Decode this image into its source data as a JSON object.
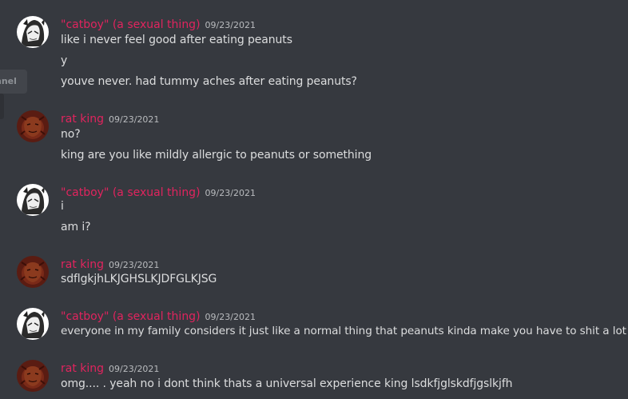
{
  "side_channel_label": "nnel",
  "messages": [
    {
      "author": "\"catboy\" (a sexual thing)",
      "time": "09/23/2021",
      "lines": [
        "like i never feel good after eating peanuts",
        "y",
        "youve never. had tummy aches after eating peanuts?"
      ]
    },
    {
      "author": "rat king",
      "time": "09/23/2021",
      "lines": [
        "no?",
        "king are you like mildly allergic to peanuts or something"
      ]
    },
    {
      "author": "\"catboy\" (a sexual thing)",
      "time": "09/23/2021",
      "lines": [
        "i",
        "am i?"
      ]
    },
    {
      "author": "rat king",
      "time": "09/23/2021",
      "lines": [
        "sdflgkjhLKJGHSLKJDFGLKJSG"
      ]
    },
    {
      "author": "\"catboy\" (a sexual thing)",
      "time": "09/23/2021",
      "lines": [
        "everyone in my family considers it just like a normal thing that peanuts kinda make you have to shit a lot"
      ]
    },
    {
      "author": "rat king",
      "time": "09/23/2021",
      "lines": [
        "omg.... . yeah no i dont think thats a universal experience king lsdkfjglskdfjgslkjfh"
      ]
    }
  ],
  "colors": {
    "background": "#36393f",
    "username": "#e0245e",
    "text": "#dcddde",
    "timestamp": "#b9bbbe"
  }
}
